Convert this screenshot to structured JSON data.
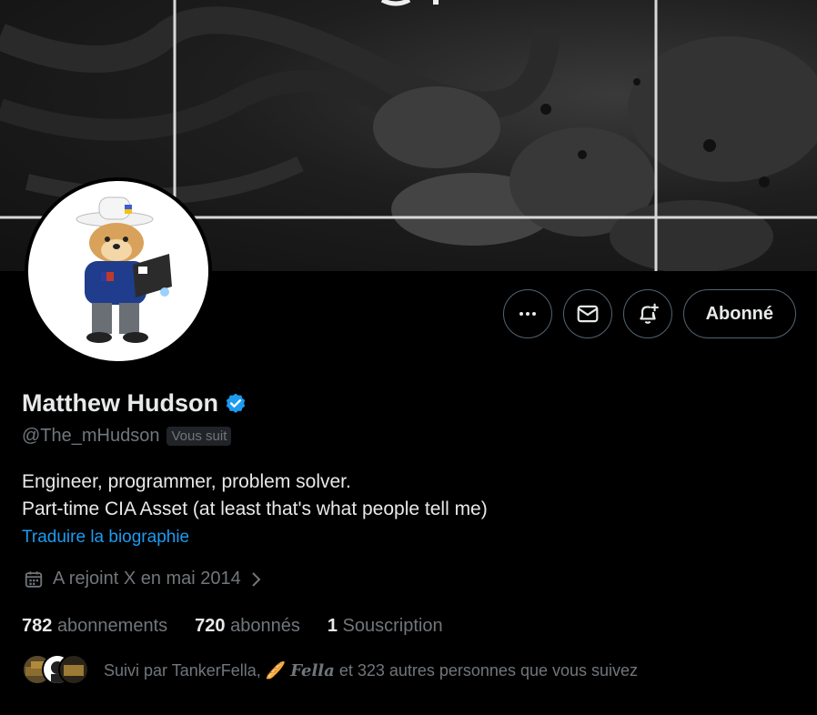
{
  "profile": {
    "display_name": "Matthew Hudson",
    "handle": "@The_mHudson",
    "follows_you_badge": "Vous suit",
    "verified": true,
    "bio_line1": "Engineer, programmer, problem solver.",
    "bio_line2": "Part-time CIA Asset (at least that's what people tell me)",
    "translate_link": "Traduire la biographie",
    "joined": "A rejoint X en mai 2014"
  },
  "actions": {
    "more_icon": "more-horizontal-icon",
    "message_icon": "envelope-icon",
    "notify_icon": "bell-plus-icon",
    "follow_label": "Abonné"
  },
  "stats": {
    "following_count": "782",
    "following_label": "abonnements",
    "followers_count": "720",
    "followers_label": "abonnés",
    "subscriptions_count": "1",
    "subscriptions_label": "Souscription"
  },
  "followed_by": {
    "prefix": "Suivi par TankerFella,",
    "emoji": "🥖",
    "fella": "Fella",
    "suffix": "et 323 autres personnes que vous suivez"
  },
  "colors": {
    "background": "#000000",
    "text": "#e7e9ea",
    "muted": "#71767b",
    "link": "#1d9bf0",
    "border": "#536471",
    "verified": "#1d9bf0"
  }
}
